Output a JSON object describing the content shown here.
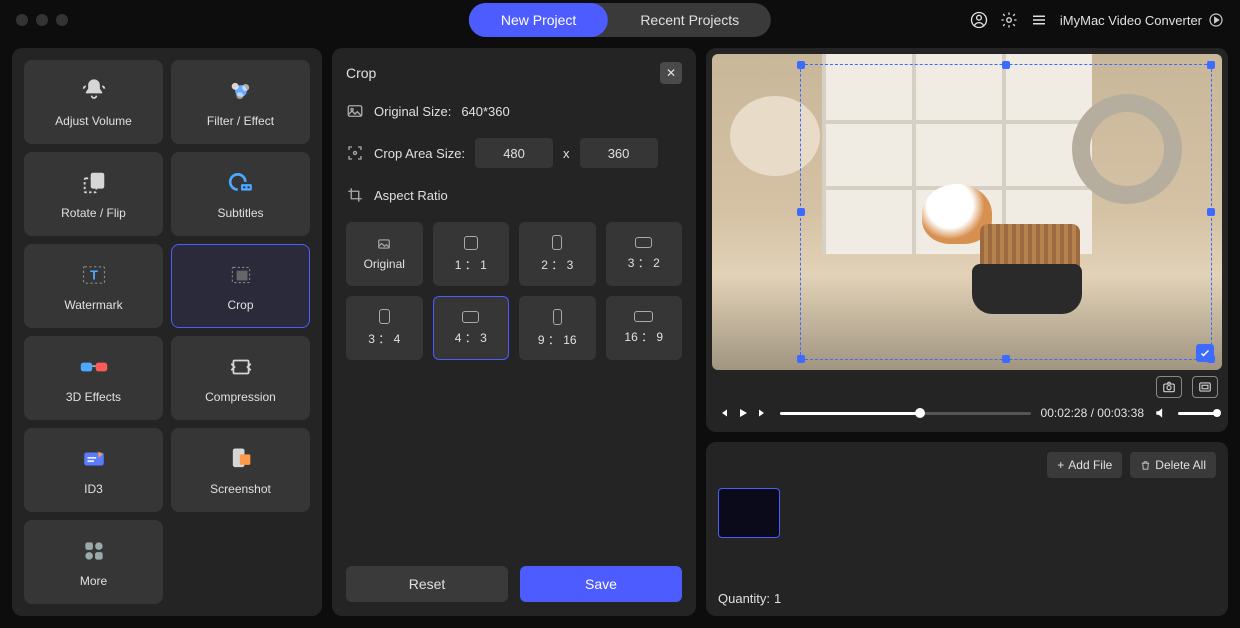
{
  "tabs": {
    "new": "New Project",
    "recent": "Recent Projects"
  },
  "app_name": "iMyMac Video Converter",
  "sidebar": {
    "items": [
      {
        "label": "Adjust Volume",
        "icon": "bell"
      },
      {
        "label": "Filter / Effect",
        "icon": "sparkle"
      },
      {
        "label": "Rotate / Flip",
        "icon": "rotate"
      },
      {
        "label": "Subtitles",
        "icon": "subtitles"
      },
      {
        "label": "Watermark",
        "icon": "watermark"
      },
      {
        "label": "Crop",
        "icon": "crop",
        "active": true
      },
      {
        "label": "3D Effects",
        "icon": "glasses"
      },
      {
        "label": "Compression",
        "icon": "compress"
      },
      {
        "label": "ID3",
        "icon": "id3"
      },
      {
        "label": "Screenshot",
        "icon": "screenshot"
      },
      {
        "label": "More",
        "icon": "more"
      }
    ]
  },
  "panel": {
    "title": "Crop",
    "original_label": "Original Size:",
    "original_value": "640*360",
    "crop_label": "Crop Area Size:",
    "crop_w": "480",
    "crop_h": "360",
    "crop_sep": "x",
    "ratio_label": "Aspect Ratio",
    "ratios": [
      {
        "label": "Original",
        "w": 18,
        "h": 12
      },
      {
        "label": "1 ： 1",
        "w": 14,
        "h": 14
      },
      {
        "label": "2 ： 3",
        "w": 10,
        "h": 15
      },
      {
        "label": "3 ： 2",
        "w": 17,
        "h": 11
      },
      {
        "label": "3 ： 4",
        "w": 11,
        "h": 15
      },
      {
        "label": "4 ： 3",
        "w": 17,
        "h": 12,
        "active": true
      },
      {
        "label": "9 ： 16",
        "w": 9,
        "h": 16
      },
      {
        "label": "16 ： 9",
        "w": 19,
        "h": 11
      }
    ],
    "reset": "Reset",
    "save": "Save"
  },
  "playback": {
    "current": "00:02:28",
    "total": "00:03:38",
    "progress_pct": 56
  },
  "queue": {
    "add": "Add File",
    "delete": "Delete All",
    "quantity_label": "Quantity:",
    "quantity": "1"
  }
}
